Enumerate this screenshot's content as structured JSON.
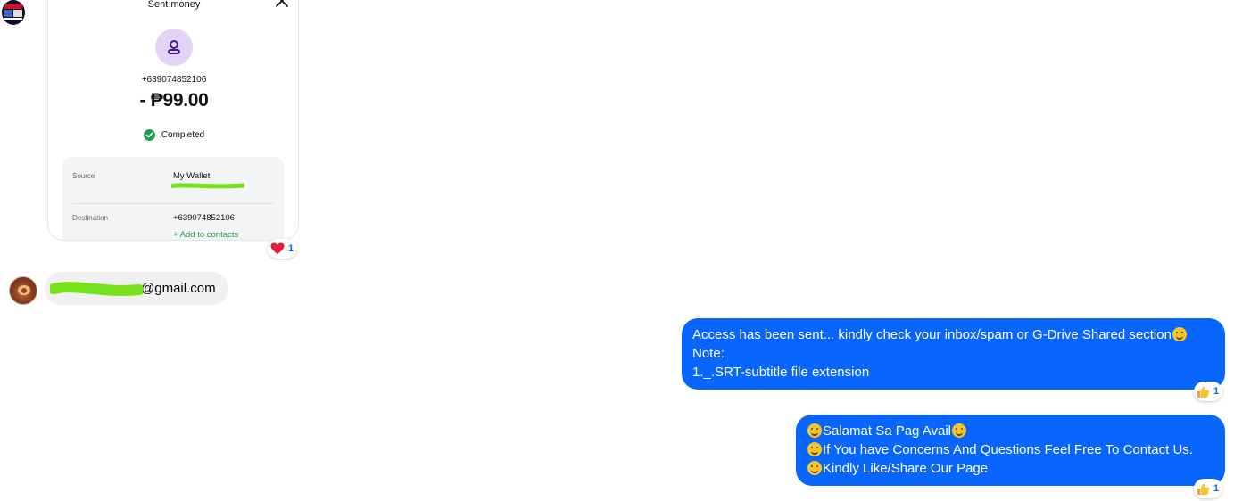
{
  "messages": {
    "receipt": {
      "title": "Sent money",
      "recipient_phone": "+639074852106",
      "amount": "- ₱99.00",
      "status": "Completed",
      "source_label": "Source",
      "source_value": "My Wallet",
      "destination_label": "Destination",
      "destination_value": "+639074852106",
      "add_contacts": "+ Add to contacts"
    },
    "receipt_reaction": {
      "emoji": "heart-icon",
      "count": "1"
    },
    "incoming_email": {
      "text": "@gmail.com"
    },
    "outgoing_1": {
      "lines": [
        "Access has been sent... kindly check your inbox/spam or G-Drive Shared section",
        "Note:",
        "1._.SRT-subtitle file extension"
      ],
      "reaction_emoji": "thumbs-up-icon",
      "reaction_count": "1"
    },
    "outgoing_2": {
      "lines": [
        "Salamat Sa Pag Avail",
        "If You have Concerns And Questions Feel Free To Contact Us.",
        "Kindly Like/Share Our Page"
      ],
      "reaction_emoji": "thumbs-up-icon",
      "reaction_count": "1"
    }
  },
  "colors": {
    "outgoing_bubble": "#0866ff",
    "incoming_bubble": "#f0f0f0",
    "status_green": "#1f9d55",
    "redaction_green": "#76e01a"
  }
}
